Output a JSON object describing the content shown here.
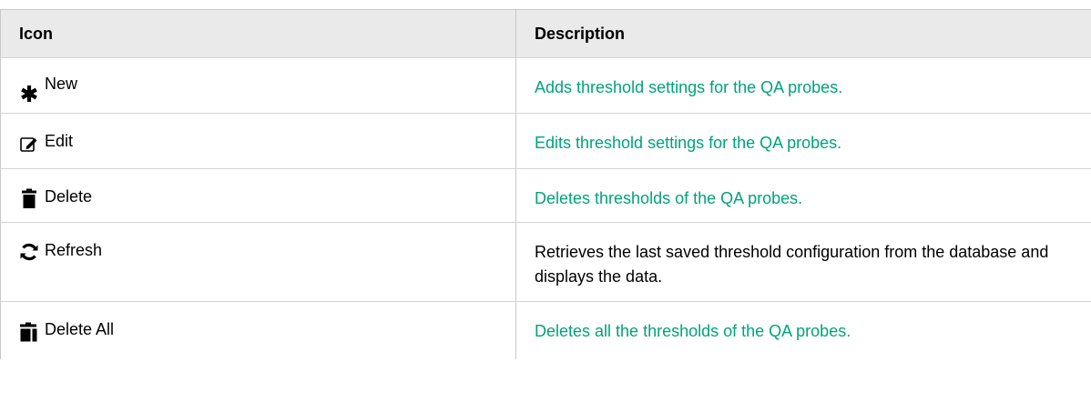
{
  "table": {
    "headers": {
      "icon": "Icon",
      "description": "Description"
    },
    "rows": [
      {
        "icon_name": "asterisk-icon",
        "label": "New",
        "description": "Adds threshold settings for the QA probes.",
        "is_link": true
      },
      {
        "icon_name": "edit-icon",
        "label": "Edit",
        "description": "Edits threshold settings for the QA probes.",
        "is_link": true
      },
      {
        "icon_name": "trash-icon",
        "label": "Delete",
        "description": "Deletes thresholds of the QA probes.",
        "is_link": true
      },
      {
        "icon_name": "refresh-icon",
        "label": "Refresh",
        "description": "Retrieves the last saved threshold configuration from the database and displays the data.",
        "is_link": false
      },
      {
        "icon_name": "delete-all-icon",
        "label": "Delete All",
        "description": "Deletes all the thresholds of the QA probes.",
        "is_link": true
      }
    ]
  },
  "colors": {
    "link": "#00a37a",
    "header_bg": "#eaeaea",
    "border": "#c9c9c9"
  }
}
